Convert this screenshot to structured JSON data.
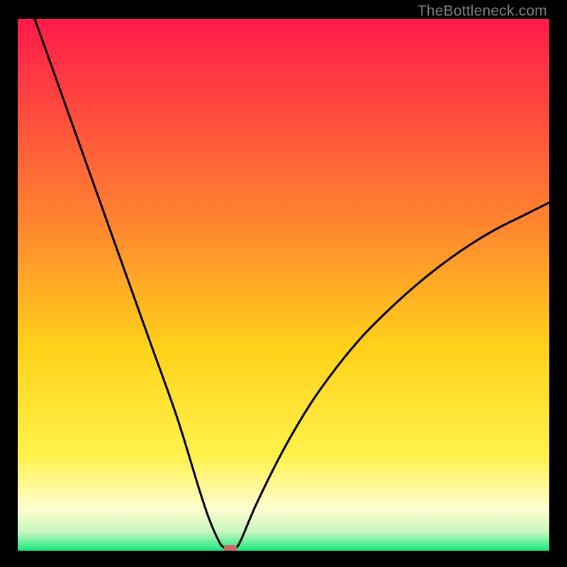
{
  "attribution": "TheBottleneck.com",
  "colors": {
    "gradient_top": "#ff1a4b",
    "gradient_mid1": "#ff7a2e",
    "gradient_mid2": "#ffd21a",
    "gradient_mid3": "#fff24a",
    "gradient_mid4": "#fffccc",
    "gradient_bottom": "#17e87c",
    "curve": "#000000",
    "marker": "#d06868",
    "frame_bg": "#000000"
  },
  "chart_data": {
    "type": "line",
    "title": "",
    "xlabel": "",
    "ylabel": "",
    "xlim": [
      0,
      100
    ],
    "ylim": [
      0,
      100
    ],
    "annotations": [],
    "series": [
      {
        "name": "bottleneck-curve",
        "x": [
          0,
          5,
          10,
          15,
          20,
          25,
          30,
          34,
          36,
          38,
          39,
          40,
          41,
          42,
          45,
          50,
          55,
          60,
          65,
          70,
          75,
          80,
          85,
          90,
          95,
          100
        ],
        "values": [
          109,
          95,
          81,
          67,
          53,
          39,
          25,
          12,
          6,
          1.5,
          0.5,
          0,
          0.5,
          2,
          9,
          19,
          27.5,
          34.5,
          40.5,
          45.5,
          50,
          54,
          57.5,
          60.5,
          63,
          65.5
        ]
      }
    ],
    "marker": {
      "x": 40,
      "y": 0
    },
    "gradient_stops": [
      {
        "pos": 0.0,
        "color": "#ff1a4b"
      },
      {
        "pos": 0.4,
        "color": "#ff8a2e"
      },
      {
        "pos": 0.62,
        "color": "#ffd21a"
      },
      {
        "pos": 0.82,
        "color": "#fff24a"
      },
      {
        "pos": 0.92,
        "color": "#fffdd0"
      },
      {
        "pos": 0.965,
        "color": "#c8f7c0"
      },
      {
        "pos": 1.0,
        "color": "#17e87c"
      }
    ]
  }
}
